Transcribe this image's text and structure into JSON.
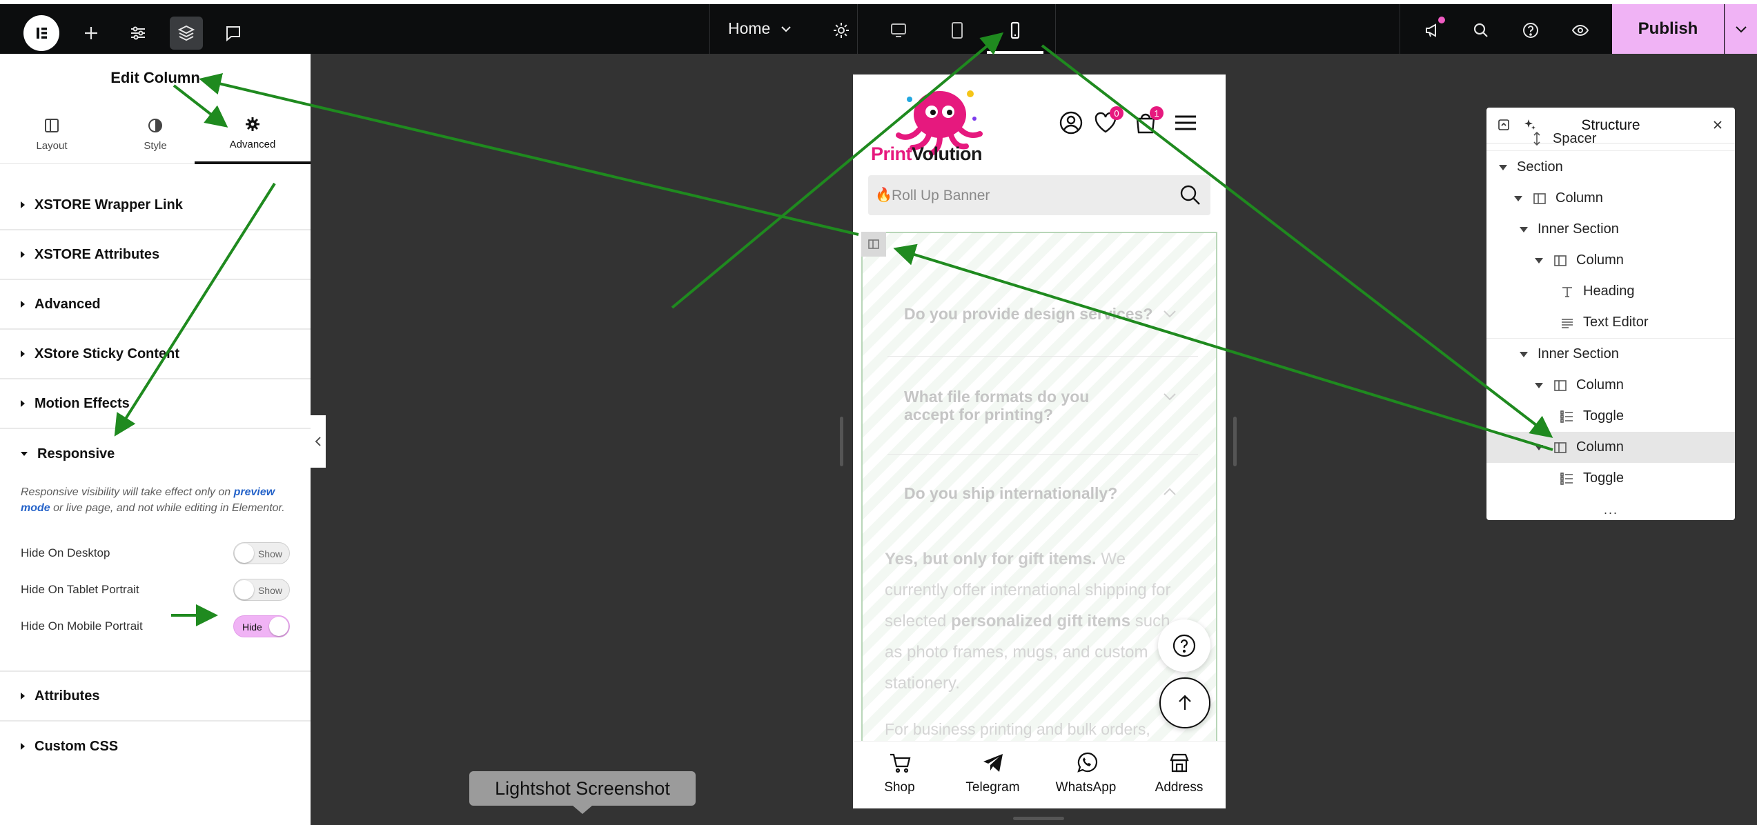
{
  "topbar": {
    "page_name": "Home",
    "publish_label": "Publish"
  },
  "panel": {
    "title": "Edit Column",
    "tabs": [
      {
        "label": "Layout"
      },
      {
        "label": "Style"
      },
      {
        "label": "Advanced"
      }
    ],
    "sections": [
      {
        "label": "XSTORE Wrapper Link"
      },
      {
        "label": "XSTORE Attributes"
      },
      {
        "label": "Advanced"
      },
      {
        "label": "XStore Sticky Content"
      },
      {
        "label": "Motion Effects"
      },
      {
        "label": "Responsive"
      },
      {
        "label": "Attributes"
      },
      {
        "label": "Custom CSS"
      }
    ],
    "responsive": {
      "note_part1": "Responsive visibility will take effect only on ",
      "note_link": "preview mode",
      "note_part2": " or live page, and not while editing in Elementor.",
      "hide_desktop_label": "Hide On Desktop",
      "hide_desktop_state": "Show",
      "hide_tablet_label": "Hide On Tablet Portrait",
      "hide_tablet_state": "Show",
      "hide_mobile_label": "Hide On Mobile Portrait",
      "hide_mobile_state": "Hide"
    }
  },
  "preview": {
    "brand_part1": "Print",
    "brand_part2": "Volution",
    "wishlist_count": "0",
    "cart_count": "1",
    "search_placeholder": "Roll Up Banner",
    "faq": [
      {
        "question": "Do you provide design services?"
      },
      {
        "question": "What file formats do you accept for printing?"
      },
      {
        "question": "Do you ship internationally?"
      }
    ],
    "answer_bold1": "Yes, but only for gift items.",
    "answer_text1": " We currently offer international shipping for selected ",
    "answer_bold2": "personalized gift items",
    "answer_text2": " such as photo frames, mugs, and custom stationery.",
    "answer2": "For business printing and bulk orders,",
    "bottom_nav": [
      {
        "label": "Shop"
      },
      {
        "label": "Telegram"
      },
      {
        "label": "WhatsApp"
      },
      {
        "label": "Address"
      }
    ]
  },
  "structure": {
    "title": "Structure",
    "items": [
      {
        "label": "Spacer"
      },
      {
        "label": "Section"
      },
      {
        "label": "Column"
      },
      {
        "label": "Inner Section"
      },
      {
        "label": "Column"
      },
      {
        "label": "Heading"
      },
      {
        "label": "Text Editor"
      },
      {
        "label": "Inner Section"
      },
      {
        "label": "Column"
      },
      {
        "label": "Toggle"
      },
      {
        "label": "Column"
      },
      {
        "label": "Toggle"
      }
    ],
    "more": "..."
  },
  "tooltip": {
    "label": "Lightshot Screenshot"
  },
  "colors": {
    "accent_pink": "#f0b3f5",
    "arrow_green": "#1f8a1f",
    "brand_magenta": "#e6197e"
  }
}
